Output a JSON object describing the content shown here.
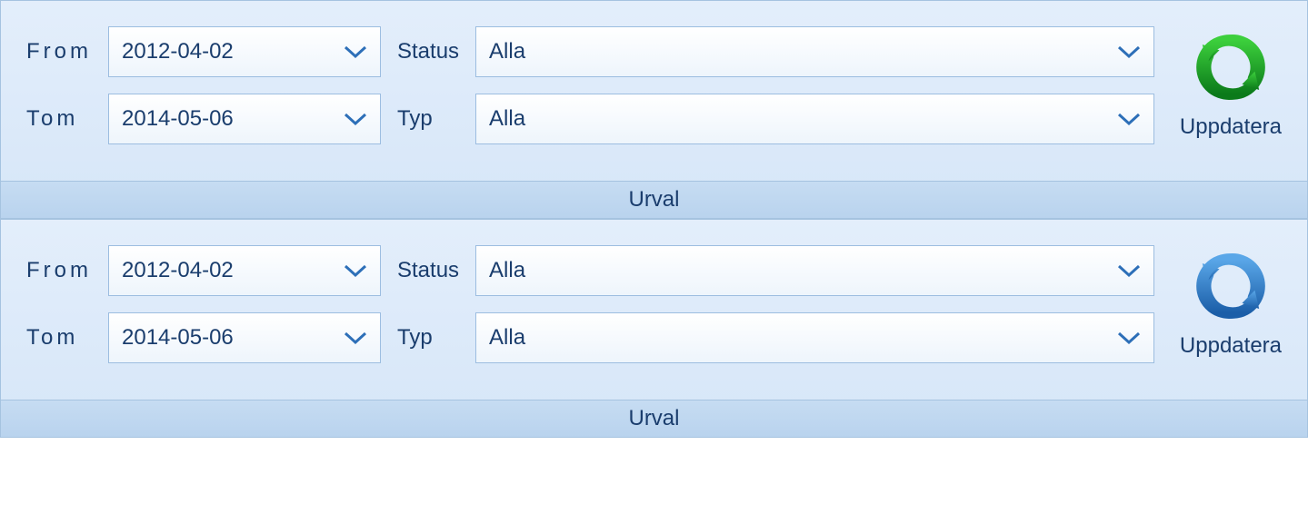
{
  "panels": [
    {
      "from_label": "From",
      "from_value": "2012-04-02",
      "tom_label": "Tom",
      "tom_value": "2014-05-06",
      "status_label": "Status",
      "status_value": "Alla",
      "typ_label": "Typ",
      "typ_value": "Alla",
      "update_label": "Uppdatera",
      "icon_color": "green",
      "footer": "Urval"
    },
    {
      "from_label": "From",
      "from_value": "2012-04-02",
      "tom_label": "Tom",
      "tom_value": "2014-05-06",
      "status_label": "Status",
      "status_value": "Alla",
      "typ_label": "Typ",
      "typ_value": "Alla",
      "update_label": "Uppdatera",
      "icon_color": "blue",
      "footer": "Urval"
    }
  ],
  "colors": {
    "green_dark": "#0b7a1a",
    "green_light": "#3ccf3c",
    "blue_dark": "#1b5ea8",
    "blue_light": "#5aa7e8",
    "caret": "#2d6fb8"
  }
}
